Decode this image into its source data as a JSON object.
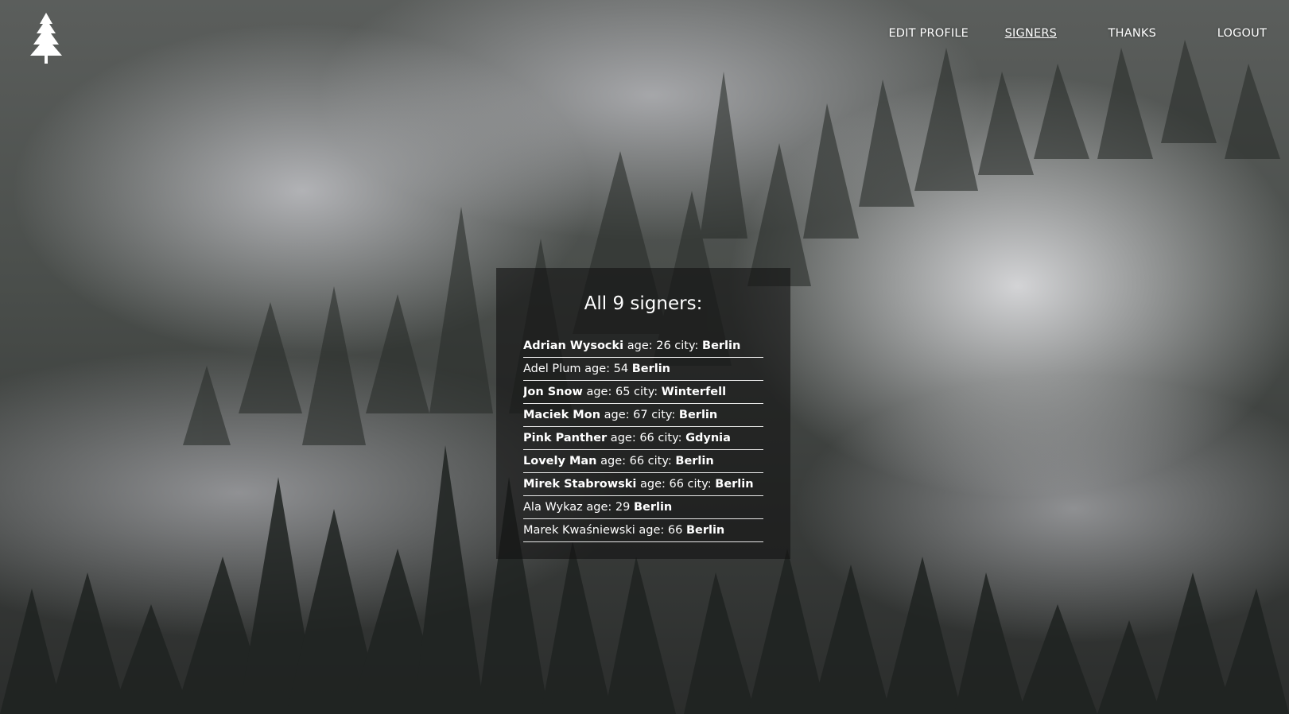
{
  "nav": {
    "items": [
      {
        "label": "EDIT PROFILE"
      },
      {
        "label": "SIGNERS"
      },
      {
        "label": "THANKS"
      },
      {
        "label": "LOGOUT"
      }
    ]
  },
  "panel": {
    "title": "All 9 signers:",
    "signers": [
      {
        "name": "Adrian Wysocki",
        "age_text": " age: 26 city: ",
        "city": "Berlin"
      },
      {
        "name": "Adel Plum",
        "age_text": " age: 54 ",
        "city": "Berlin"
      },
      {
        "name": "Jon Snow",
        "age_text": "  age: 65 city: ",
        "city": "Winterfell"
      },
      {
        "name": "Maciek Mon",
        "age_text": " age: 67 city: ",
        "city": "Berlin"
      },
      {
        "name": "Pink Panther",
        "age_text": " age: 66 city: ",
        "city": "Gdynia"
      },
      {
        "name": "Lovely Man",
        "age_text": " age: 66 city: ",
        "city": "Berlin"
      },
      {
        "name": "Mirek Stabrowski",
        "age_text": "  age: 66 city: ",
        "city": "Berlin"
      },
      {
        "name": "Ala Wykaz",
        "age_text": " age: 29 ",
        "city": "Berlin"
      },
      {
        "name": "Marek Kwaśniewski",
        "age_text": " age: 66 ",
        "city": "Berlin"
      }
    ]
  },
  "colors": {
    "panel_bg": "#141414",
    "text": "#ffffff"
  }
}
